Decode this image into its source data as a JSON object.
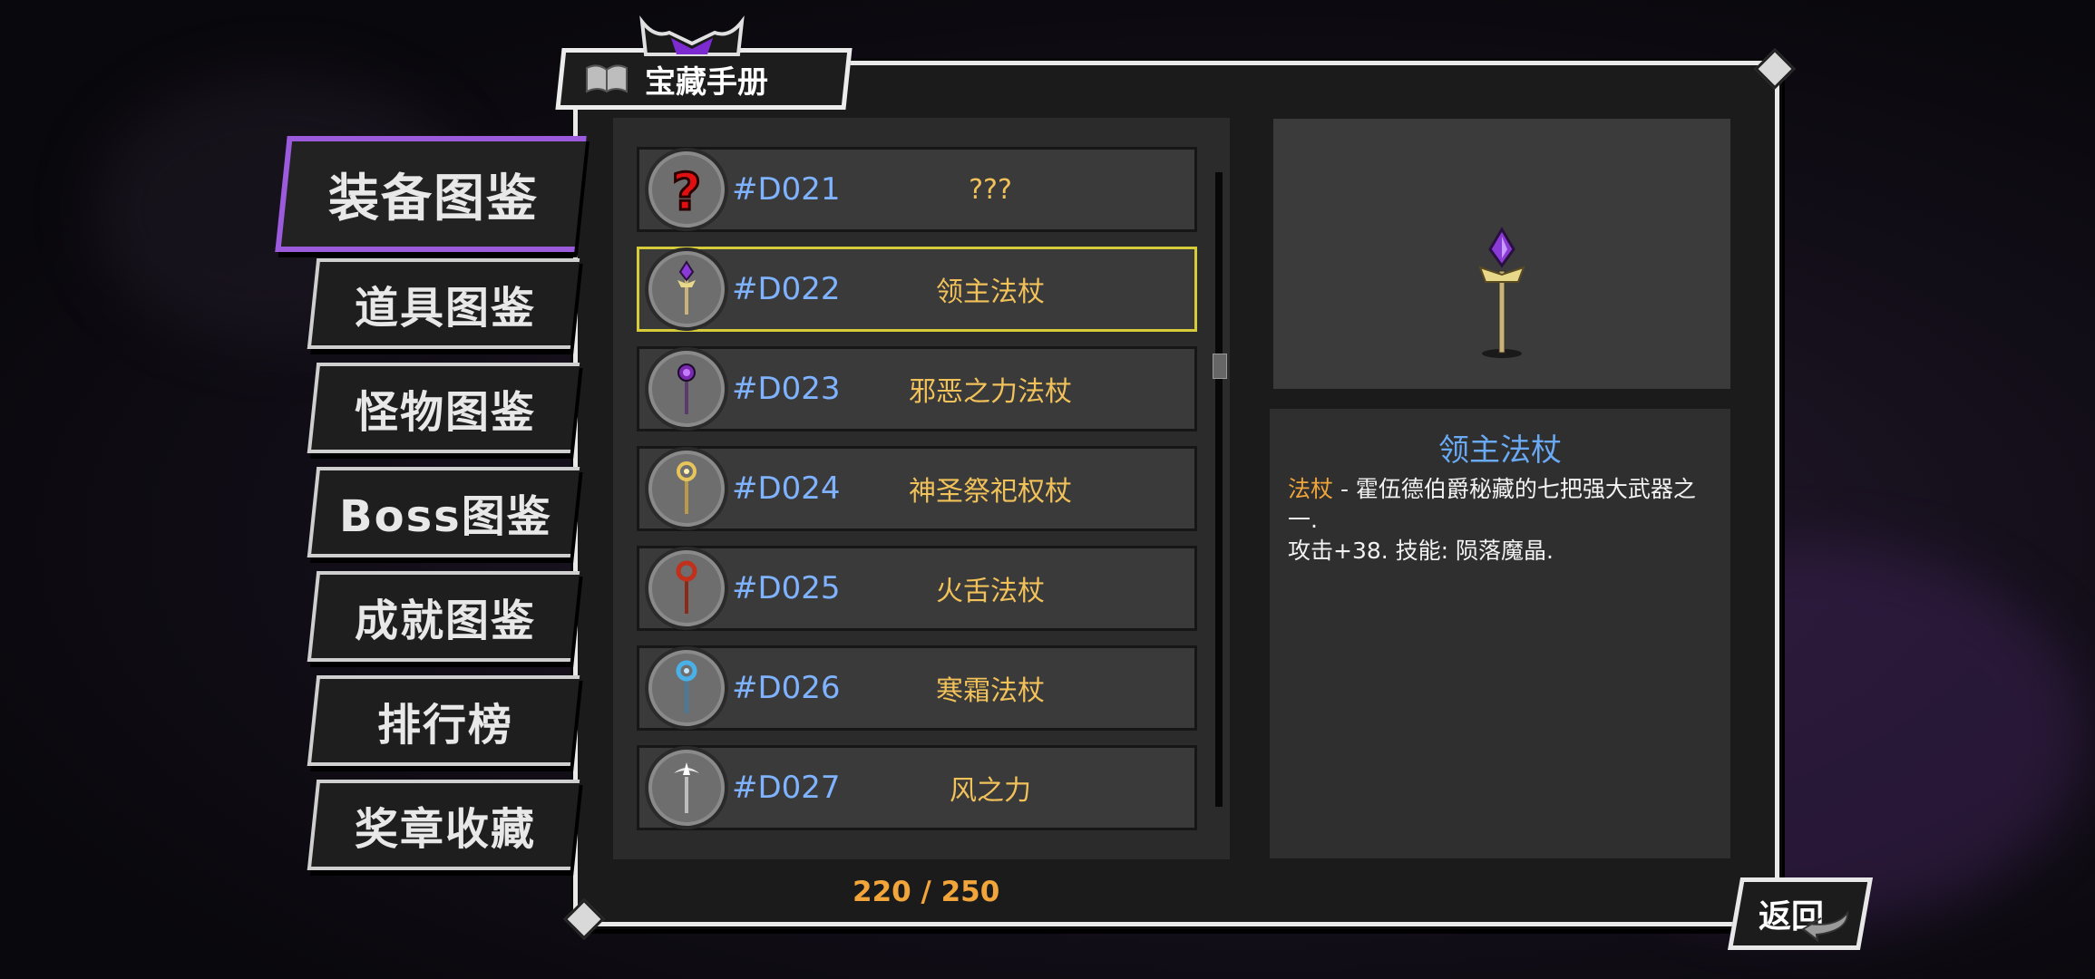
{
  "title": "宝藏手册",
  "nav": [
    {
      "label": "装备图鉴",
      "active": true
    },
    {
      "label": "道具图鉴",
      "active": false
    },
    {
      "label": "怪物图鉴",
      "active": false
    },
    {
      "label": "Boss图鉴",
      "active": false
    },
    {
      "label": "成就图鉴",
      "active": false
    },
    {
      "label": "排行榜",
      "active": false
    },
    {
      "label": "奖章收藏",
      "active": false
    }
  ],
  "items": [
    {
      "code": "#D021",
      "name": "???",
      "icon": "unknown-question-icon",
      "selected": false
    },
    {
      "code": "#D022",
      "name": "领主法杖",
      "icon": "purple-crystal-staff-icon",
      "selected": true
    },
    {
      "code": "#D023",
      "name": "邪恶之力法杖",
      "icon": "dark-purple-staff-icon",
      "selected": false
    },
    {
      "code": "#D024",
      "name": "神圣祭祀权杖",
      "icon": "holy-gold-scepter-icon",
      "selected": false
    },
    {
      "code": "#D025",
      "name": "火舌法杖",
      "icon": "red-fire-staff-icon",
      "selected": false
    },
    {
      "code": "#D026",
      "name": "寒霜法杖",
      "icon": "blue-frost-staff-icon",
      "selected": false
    },
    {
      "code": "#D027",
      "name": "风之力",
      "icon": "silver-wind-staff-icon",
      "selected": false
    }
  ],
  "counter": "220 / 250",
  "detail": {
    "name": "领主法杖",
    "type": "法杖",
    "description": " - 霍伍德伯爵秘藏的七把强大武器之一.",
    "stats": "攻击+38. 技能: 陨落魔晶."
  },
  "back_label": "返回",
  "colors": {
    "accent_purple": "#9b5bdc",
    "selected_yellow": "#d6cc3a",
    "code_blue": "#7fb2ff",
    "name_gold": "#f1c15a",
    "counter_orange": "#f1a53a",
    "title_blue": "#6aaaf5"
  }
}
